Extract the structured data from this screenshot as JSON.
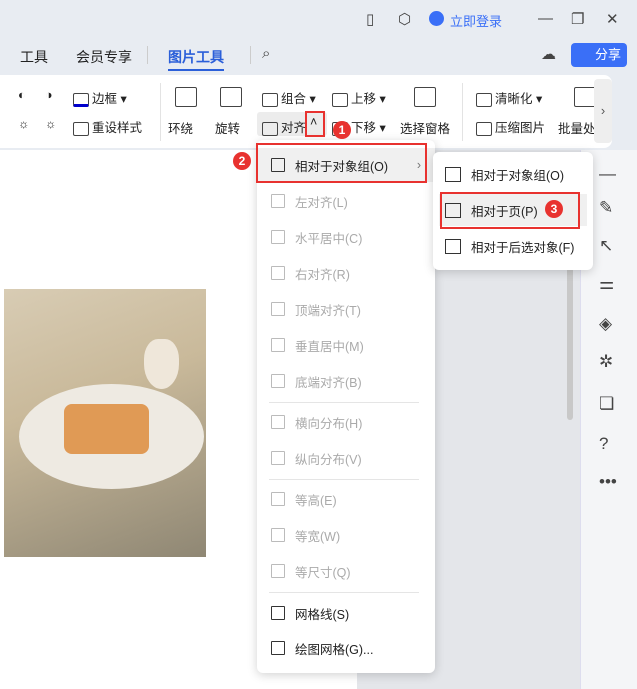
{
  "titlebar": {
    "login": "立即登录"
  },
  "tabs": [
    {
      "label": "工具"
    },
    {
      "label": "会员专享"
    },
    {
      "label": "图片工具"
    }
  ],
  "share": "分享",
  "ribbon": {
    "border": "边框",
    "reset_style": "重设样式",
    "wrap": "环绕",
    "rotate": "旋转",
    "group": "组合",
    "align": "对齐",
    "bring_forward": "上移",
    "send_backward": "下移",
    "selection_pane": "选择窗格",
    "sharpen": "清晰化",
    "compress": "压缩图片",
    "batch": "批量处"
  },
  "menu": {
    "items": [
      {
        "label": "相对于对象组(O)",
        "enabled": true
      },
      {
        "label": "左对齐(L)",
        "enabled": false
      },
      {
        "label": "水平居中(C)",
        "enabled": false
      },
      {
        "label": "右对齐(R)",
        "enabled": false
      },
      {
        "label": "顶端对齐(T)",
        "enabled": false
      },
      {
        "label": "垂直居中(M)",
        "enabled": false
      },
      {
        "label": "底端对齐(B)",
        "enabled": false
      },
      {
        "label": "横向分布(H)",
        "enabled": false
      },
      {
        "label": "纵向分布(V)",
        "enabled": false
      },
      {
        "label": "等高(E)",
        "enabled": false
      },
      {
        "label": "等宽(W)",
        "enabled": false
      },
      {
        "label": "等尺寸(Q)",
        "enabled": false
      },
      {
        "label": "网格线(S)",
        "enabled": true
      },
      {
        "label": "绘图网格(G)...",
        "enabled": true
      }
    ]
  },
  "submenu": {
    "items": [
      {
        "label": "相对于对象组(O)"
      },
      {
        "label": "相对于页(P)"
      },
      {
        "label": "相对于后选对象(F)"
      }
    ]
  },
  "badges": [
    "1",
    "2",
    "3"
  ],
  "accent": "#3a6ff7"
}
